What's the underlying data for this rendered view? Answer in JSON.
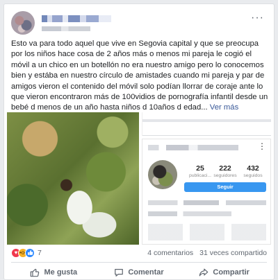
{
  "post": {
    "text_main": "Esto va para todo aquel que vive en Segovia capital y que se preocupa por los niños hace cosa de 2 años más o menos mi pareja le cogió el móvil a un chico en un botellón no era nuestro amigo pero lo conocemos bien y estába en nuestro círculo de amistades cuando mi pareja y par de amigos vieron el contenido del móvil solo podían llorrar de coraje ante lo que vieron encontraron más de 100vidios de pornografía infantil desde un bebé d menos de un año hasta niños d 10años d edad...",
    "see_more": "Ver más"
  },
  "instagram_profile": {
    "posts_count": "25",
    "posts_label": "publicaci...",
    "followers_count": "222",
    "followers_label": "seguidores",
    "following_count": "432",
    "following_label": "seguidos",
    "follow_button": "Seguir"
  },
  "footer": {
    "reaction_count": "7",
    "comments": "4 comentarios",
    "shares": "31 veces compartido",
    "like_label": "Me gusta",
    "comment_label": "Comentar",
    "share_label": "Compartir"
  },
  "colors": {
    "link": "#385898",
    "follow_button": "#3897f0",
    "love_reaction": "#f0384d",
    "wow_reaction": "#f7b125",
    "like_reaction": "#2d88ff"
  }
}
